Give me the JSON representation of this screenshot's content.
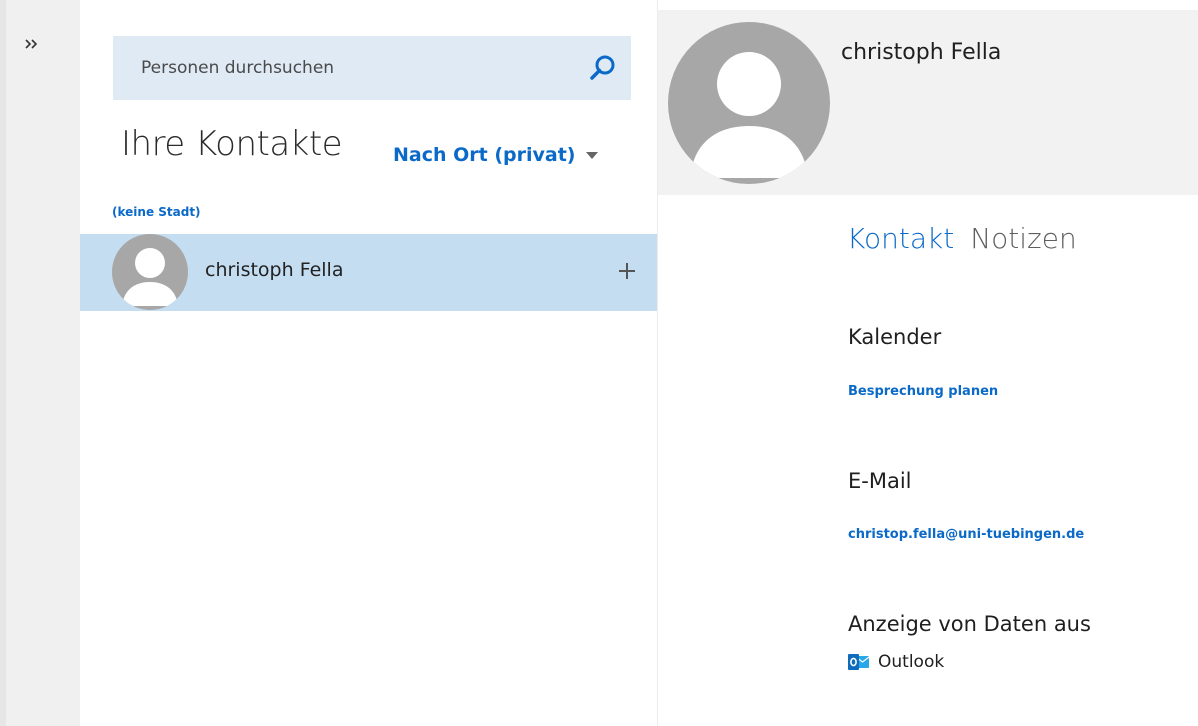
{
  "search": {
    "placeholder": "Personen durchsuchen"
  },
  "list": {
    "title": "Ihre Kontakte",
    "sort_label": "Nach Ort (privat)",
    "group_header": "(keine Stadt)",
    "contacts": [
      {
        "name": "christoph Fella"
      }
    ]
  },
  "detail": {
    "name": "christoph Fella",
    "tabs": [
      {
        "label": "Kontakt",
        "active": true
      },
      {
        "label": "Notizen",
        "active": false
      }
    ],
    "calendar": {
      "heading": "Kalender",
      "action": "Besprechung planen"
    },
    "email": {
      "heading": "E-Mail",
      "address": "christop.fella@uni-tuebingen.de"
    },
    "source": {
      "heading": "Anzeige von Daten aus",
      "label": "Outlook"
    }
  },
  "colors": {
    "accent": "#0b6ac8",
    "selected_row": "#c5ddf1",
    "search_bg": "#dfeaf5",
    "avatar_gray": "#a7a7a7",
    "outlook_blue": "#0f6cbd"
  },
  "icons": {
    "rail_toggle": "double-chevron-right-icon",
    "search": "search-icon",
    "add": "plus-icon",
    "dropdown": "caret-down-icon",
    "avatar": "person-avatar-icon",
    "outlook": "outlook-logo-icon"
  }
}
